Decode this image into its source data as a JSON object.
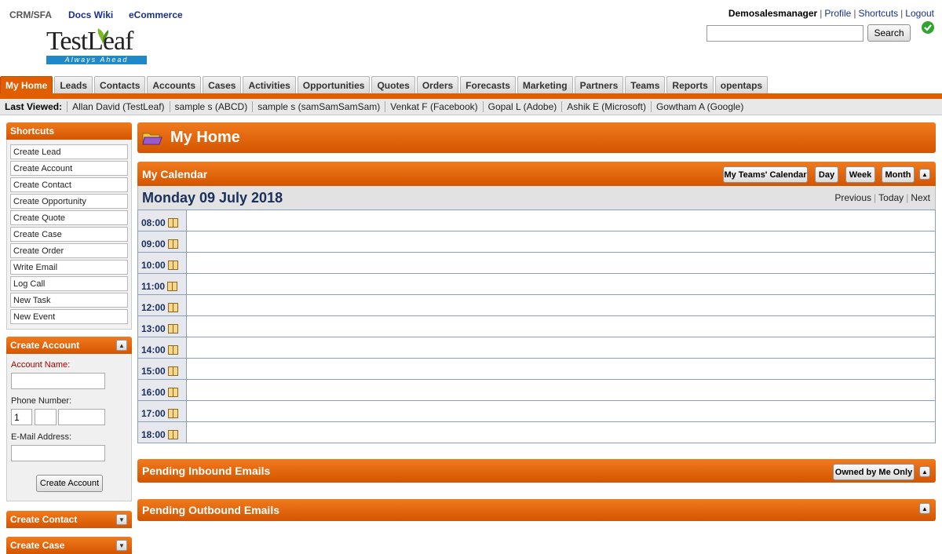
{
  "app_links": [
    "CRM/SFA",
    "Docs Wiki",
    "eCommerce"
  ],
  "logo": {
    "name": "TestLeaf",
    "tagline": "Always Ahead"
  },
  "header": {
    "username": "Demosalesmanager",
    "links": [
      "Profile",
      "Shortcuts",
      "Logout"
    ],
    "search_button": "Search",
    "search_value": ""
  },
  "tabs": [
    "My Home",
    "Leads",
    "Contacts",
    "Accounts",
    "Cases",
    "Activities",
    "Opportunities",
    "Quotes",
    "Orders",
    "Forecasts",
    "Marketing",
    "Partners",
    "Teams",
    "Reports",
    "opentaps"
  ],
  "active_tab": "My Home",
  "last_viewed": {
    "label": "Last Viewed:",
    "items": [
      "Allan David (TestLeaf)",
      "sample s (ABCD)",
      "sample s (samSamSamSam)",
      "Venkat F (Facebook)",
      "Gopal L (Adobe)",
      "Ashik E (Microsoft)",
      "Gowtham A (Google)"
    ]
  },
  "shortcuts": {
    "title": "Shortcuts",
    "items": [
      "Create Lead",
      "Create Account",
      "Create Contact",
      "Create Opportunity",
      "Create Quote",
      "Create Case",
      "Create Order",
      "Write Email",
      "Log Call",
      "New Task",
      "New Event"
    ]
  },
  "create_account": {
    "title": "Create Account",
    "account_name_label": "Account Name:",
    "phone_label": "Phone Number:",
    "phone_country": "1",
    "email_label": "E-Mail Address:",
    "submit": "Create Account"
  },
  "create_contact": {
    "title": "Create Contact"
  },
  "create_case": {
    "title": "Create Case"
  },
  "page_title": "My Home",
  "calendar": {
    "title": "My Calendar",
    "buttons": [
      "My Teams' Calendar",
      "Day",
      "Week",
      "Month"
    ],
    "date": "Monday 09 July 2018",
    "nav": [
      "Previous",
      "Today",
      "Next"
    ],
    "hours": [
      "08:00",
      "09:00",
      "10:00",
      "11:00",
      "12:00",
      "13:00",
      "14:00",
      "15:00",
      "16:00",
      "17:00",
      "18:00"
    ]
  },
  "pending_inbound": {
    "title": "Pending Inbound Emails",
    "button": "Owned by Me Only"
  },
  "pending_outbound": {
    "title": "Pending Outbound Emails"
  },
  "colors": {
    "accent": "#e05d00",
    "accent_light": "#f07a1d",
    "link": "#1a2f8a",
    "date_text": "#1a2f5a"
  }
}
